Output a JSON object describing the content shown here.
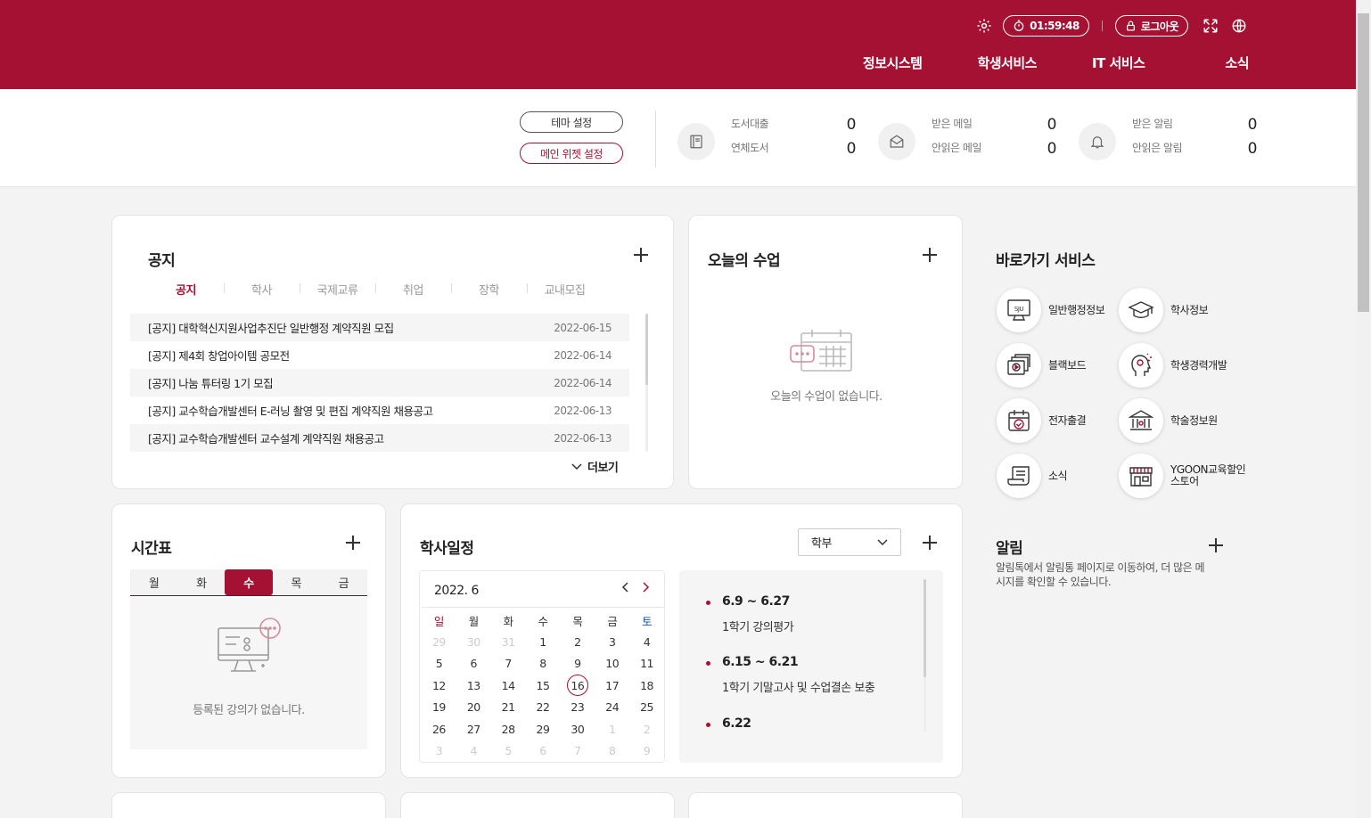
{
  "header": {
    "timer": "01:59:48",
    "logout_label": "로그아웃",
    "nav": [
      "정보시스템",
      "학생서비스",
      "IT 서비스",
      "소식"
    ]
  },
  "subbar": {
    "theme_button": "테마 설정",
    "widget_button": "메인 위젯 설정",
    "stats": [
      {
        "icon": "book-icon",
        "rows": [
          {
            "label": "도서대출",
            "value": "0"
          },
          {
            "label": "연체도서",
            "value": "0"
          }
        ]
      },
      {
        "icon": "mail-icon",
        "rows": [
          {
            "label": "받은 메일",
            "value": "0"
          },
          {
            "label": "안읽은 메일",
            "value": "0"
          }
        ]
      },
      {
        "icon": "bell-icon",
        "rows": [
          {
            "label": "받은 알림",
            "value": "0"
          },
          {
            "label": "안읽은 알림",
            "value": "0"
          }
        ]
      }
    ]
  },
  "notice": {
    "title": "공지",
    "tabs": [
      "공지",
      "학사",
      "국제교류",
      "취업",
      "장학",
      "교내모집"
    ],
    "active_tab": 0,
    "items": [
      {
        "title": "[공지]  대학혁신지원사업추진단 일반행정 계약직원 모집",
        "date": "2022-06-15"
      },
      {
        "title": "[공지]  제4회  창업아이템 공모전",
        "date": "2022-06-14"
      },
      {
        "title": "[공지]  나눔 튜터링 1기 모집",
        "date": "2022-06-14"
      },
      {
        "title": "[공지]  교수학습개발센터 E-러닝 촬영 및 편집 계약직원 채용공고",
        "date": "2022-06-13"
      },
      {
        "title": "[공지]  교수학습개발센터 교수설계 계약직원 채용공고",
        "date": "2022-06-13"
      }
    ],
    "more_label": "더보기"
  },
  "today_class": {
    "title": "오늘의 수업",
    "empty": "오늘의 수업이 없습니다."
  },
  "timetable": {
    "title": "시간표",
    "days": [
      "월",
      "화",
      "수",
      "목",
      "금"
    ],
    "active_day": 2,
    "empty": "등록된 강의가 없습니다."
  },
  "schedule": {
    "title": "학사일정",
    "select_value": "학부",
    "month": "2022. 6",
    "weekdays": [
      "일",
      "월",
      "화",
      "수",
      "목",
      "금",
      "토"
    ],
    "days": [
      [
        "29",
        "30",
        "31",
        "1",
        "2",
        "3",
        "4"
      ],
      [
        "5",
        "6",
        "7",
        "8",
        "9",
        "10",
        "11"
      ],
      [
        "12",
        "13",
        "14",
        "15",
        "16",
        "17",
        "18"
      ],
      [
        "19",
        "20",
        "21",
        "22",
        "23",
        "24",
        "25"
      ],
      [
        "26",
        "27",
        "28",
        "29",
        "30",
        "1",
        "2"
      ],
      [
        "3",
        "4",
        "5",
        "6",
        "7",
        "8",
        "9"
      ]
    ],
    "today": "16",
    "events": [
      {
        "date": "6.9 ~ 6.27",
        "text": "1학기 강의평가"
      },
      {
        "date": "6.15 ~ 6.21",
        "text": "1학기 기말고사 및 수업결손 보충"
      },
      {
        "date": "6.22",
        "text": ""
      }
    ]
  },
  "quick": {
    "title": "바로가기 서비스",
    "items": [
      {
        "label": "일반행정정보",
        "icon": "sju-monitor-icon"
      },
      {
        "label": "학사정보",
        "icon": "graduation-cap-icon"
      },
      {
        "label": "블랙보드",
        "icon": "video-board-icon"
      },
      {
        "label": "학생경력개발",
        "icon": "head-idea-icon"
      },
      {
        "label": "전자출결",
        "icon": "calendar-check-icon"
      },
      {
        "label": "학술정보원",
        "icon": "library-icon"
      },
      {
        "label": "소식",
        "icon": "news-scroll-icon"
      },
      {
        "label": "YGOON교육할인 스토어",
        "icon": "store-icon"
      }
    ]
  },
  "alarm": {
    "title": "알림",
    "text": "알림톡에서 알림통 페이지로 이동하여, 더 많은 메시지를 확인할 수 있습니다."
  },
  "colors": {
    "brand": "#a51133",
    "saturday": "#1a56c4"
  }
}
